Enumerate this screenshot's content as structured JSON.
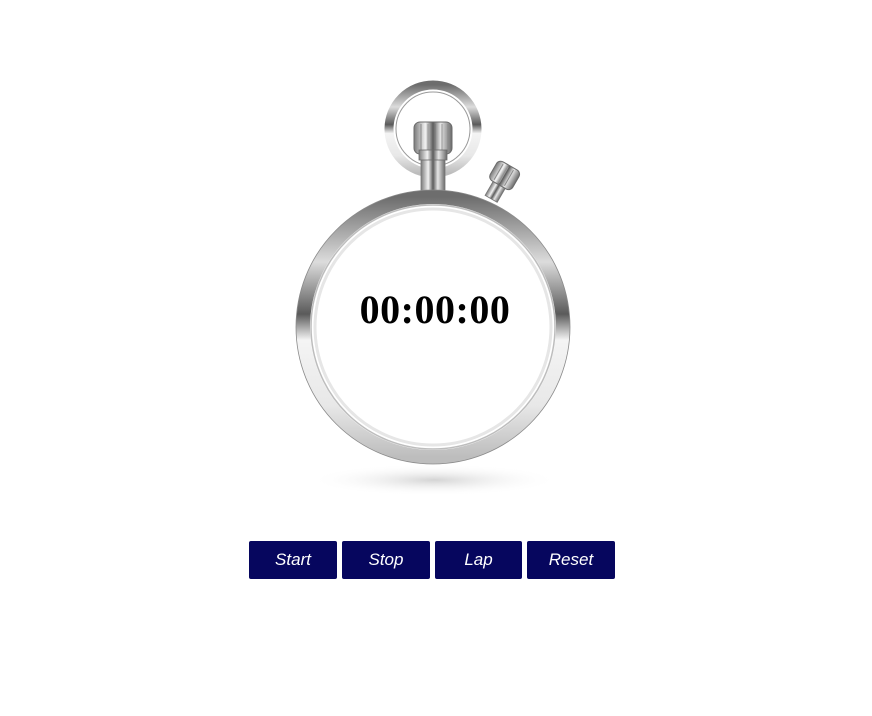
{
  "stopwatch": {
    "time": "00:00:00",
    "image": "stopwatch-image"
  },
  "controls": {
    "start_label": "Start",
    "stop_label": "Stop",
    "lap_label": "Lap",
    "reset_label": "Reset"
  },
  "colors": {
    "button_bg": "#06065e",
    "button_text": "#ffffff",
    "time_text": "#000000",
    "background": "#ffffff"
  }
}
